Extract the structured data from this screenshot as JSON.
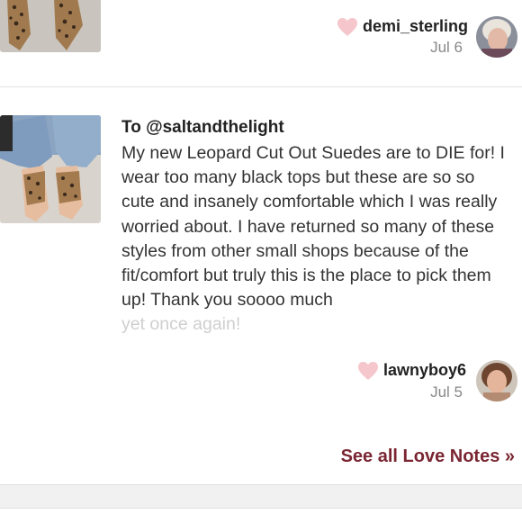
{
  "notes": [
    {
      "username": "demi_sterling",
      "date": "Jul 6",
      "heart_color": "#f5c6cc"
    },
    {
      "to": "To @saltandthelight",
      "message": "My new Leopard Cut Out Suedes are to DIE for! I wear too many black tops but these are so so cute and insanely comfortable which I was really worried about. I have returned so many of these styles from other small shops because of the fit/comfort but truly this is the place to pick them up! Thank you soooo much",
      "message_faded": "yet once again!",
      "username": "lawnyboy6",
      "date": "Jul 5",
      "heart_color": "#f5c6cc"
    }
  ],
  "footer": {
    "see_all_label": "See all Love Notes »",
    "accent": "#7a2632"
  }
}
